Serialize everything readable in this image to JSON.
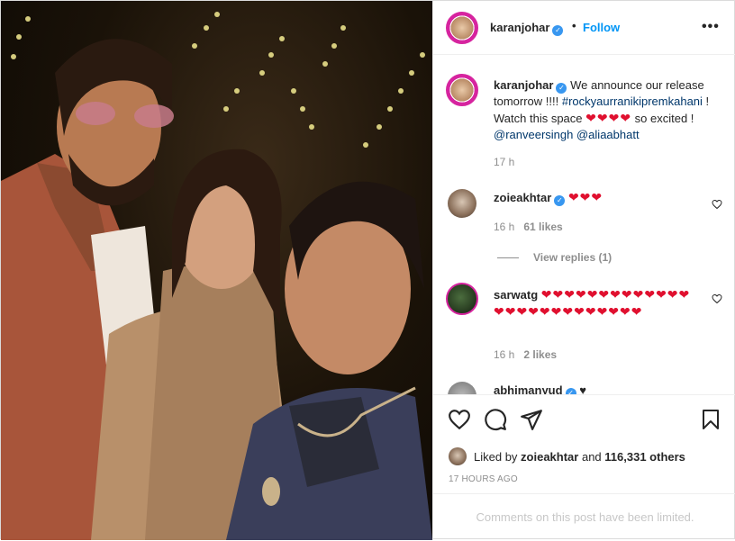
{
  "post": {
    "username": "karanjohar",
    "follow_label": "Follow",
    "separator": "•",
    "more_label": "•••"
  },
  "caption": {
    "username": "karanjohar",
    "text_1": " We announce our release tomorrow !!!! ",
    "hashtag": "#rockyaurranikipremkahani",
    "text_2": " ! Watch this space ",
    "hearts": "❤❤❤❤",
    "text_3": " so excited ! ",
    "mention_1": "@ranveersingh",
    "mention_2": "@aliaabhatt",
    "time": "17 h"
  },
  "comments": [
    {
      "username": "zoieakhtar",
      "hearts": "❤❤❤",
      "time": "16 h",
      "likes": "61 likes",
      "view_replies": "View replies (1)"
    },
    {
      "username": "sarwatg",
      "hearts": "❤❤❤❤❤❤❤❤❤❤❤❤❤❤❤❤❤❤❤❤❤❤❤❤❤❤",
      "time": "16 h",
      "likes": "2 likes"
    },
    {
      "username": "abhimanyud",
      "hearts": "♥"
    }
  ],
  "actions": {
    "liked_by_prefix": "Liked by ",
    "liked_by_user": "zoieakhtar",
    "liked_and": " and ",
    "liked_count": "116,331 others",
    "timestamp": "17 HOURS AGO"
  },
  "footer": {
    "limited_text": "Comments on this post have been limited."
  },
  "colors": {
    "accent": "#0095f6",
    "verified": "#3897f0",
    "heart": "#e0102f",
    "muted": "#8e8e8e"
  }
}
